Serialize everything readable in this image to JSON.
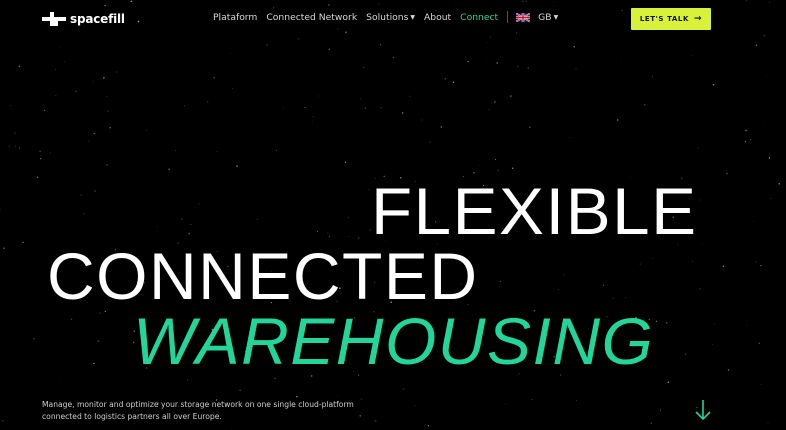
{
  "brand": {
    "name": "spacefill"
  },
  "nav": {
    "items": [
      {
        "label": "Plataform",
        "has_caret": false
      },
      {
        "label": "Connected Network",
        "has_caret": false
      },
      {
        "label": "Solutions",
        "has_caret": true
      },
      {
        "label": "About",
        "has_caret": false
      },
      {
        "label": "Connect",
        "has_caret": false,
        "active": true
      }
    ],
    "language": {
      "flag": "uk-flag-icon",
      "code": "GB"
    },
    "cta_label": "LET'S TALK"
  },
  "hero": {
    "line1": "FLEXIBLE",
    "line2": "CONNECTED",
    "line3": "WAREHOUSING",
    "description": "Manage, monitor and optimize your storage network on one single cloud-platform connected to logistics partners all over Europe."
  },
  "colors": {
    "background": "#000000",
    "accent_green": "#22d59a",
    "cta_yellow": "#d7f239",
    "text": "#ffffff"
  }
}
